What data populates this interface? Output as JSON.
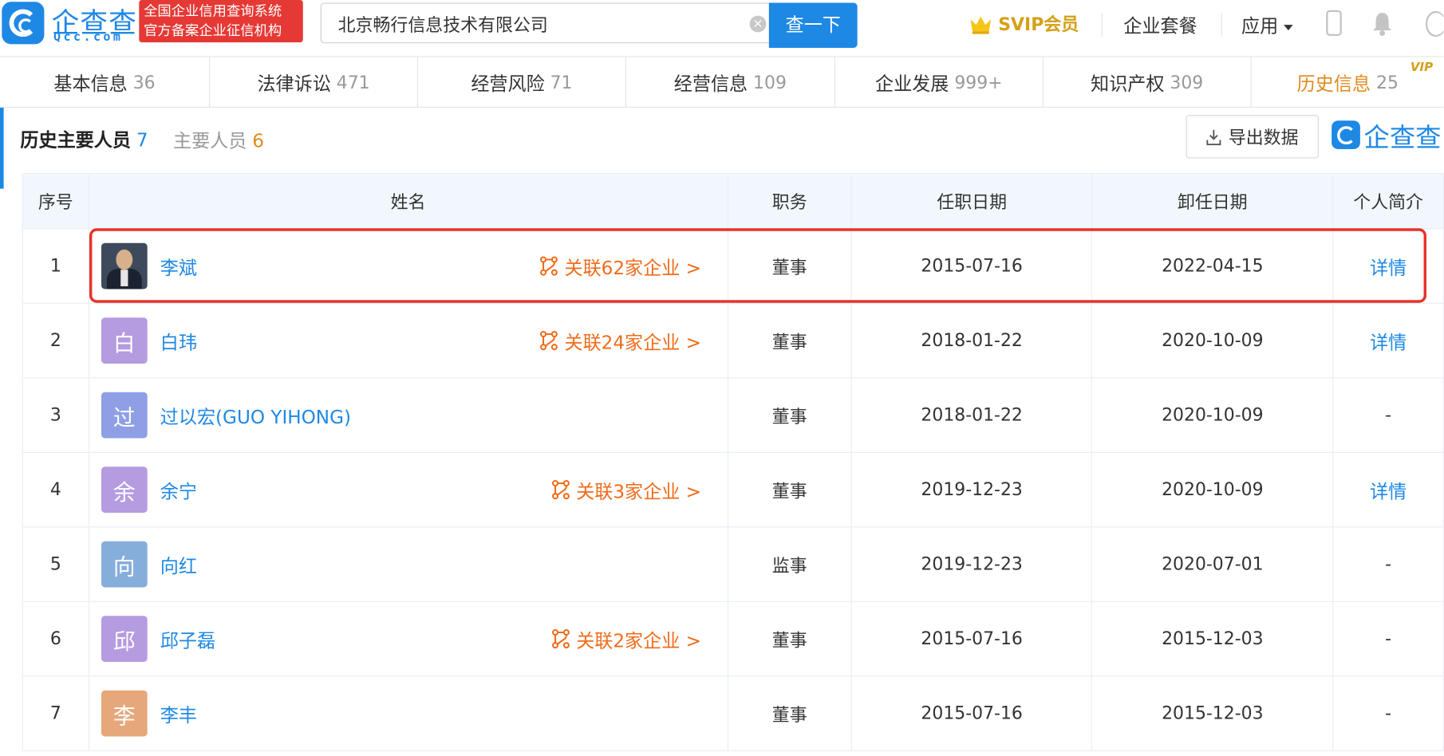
{
  "header": {
    "logo_text": "企查查",
    "logo_domain": "Qcc.com",
    "badge_line1": "全国企业信用查询系统",
    "badge_line2": "官方备案企业征信机构",
    "search_value": "北京畅行信息技术有限公司",
    "search_button": "查一下",
    "svip_label": "SVIP会员",
    "package_label": "企业套餐",
    "apps_label": "应用"
  },
  "tabs": [
    {
      "label": "基本信息",
      "count": "36"
    },
    {
      "label": "法律诉讼",
      "count": "471"
    },
    {
      "label": "经营风险",
      "count": "71"
    },
    {
      "label": "经营信息",
      "count": "109"
    },
    {
      "label": "企业发展",
      "count": "999+"
    },
    {
      "label": "知识产权",
      "count": "309"
    },
    {
      "label": "历史信息",
      "count": "25",
      "vip": "VIP",
      "active": true
    }
  ],
  "section": {
    "title": "历史主要人员",
    "title_count": "7",
    "sub": "主要人员",
    "sub_count": "6",
    "export_label": "导出数据",
    "watermark": "企查查"
  },
  "table": {
    "headers": [
      "序号",
      "姓名",
      "职务",
      "任职日期",
      "卸任日期",
      "个人简介"
    ],
    "rows": [
      {
        "no": "1",
        "avatar_char": "",
        "avatar_color": "#3d4a5c",
        "name": "李斌",
        "related": "关联62家企业 >",
        "position": "董事",
        "start": "2015-07-16",
        "end": "2022-04-15",
        "profile": "详情"
      },
      {
        "no": "2",
        "avatar_char": "白",
        "avatar_color": "#b59be0",
        "name": "白玮",
        "related": "关联24家企业 >",
        "position": "董事",
        "start": "2018-01-22",
        "end": "2020-10-09",
        "profile": "详情"
      },
      {
        "no": "3",
        "avatar_char": "过",
        "avatar_color": "#8f9fe6",
        "name": "过以宏(GUO YIHONG)",
        "related": "",
        "position": "董事",
        "start": "2018-01-22",
        "end": "2020-10-09",
        "profile": "-"
      },
      {
        "no": "4",
        "avatar_char": "余",
        "avatar_color": "#b59be0",
        "name": "余宁",
        "related": "关联3家企业 >",
        "position": "董事",
        "start": "2019-12-23",
        "end": "2020-10-09",
        "profile": "详情"
      },
      {
        "no": "5",
        "avatar_char": "向",
        "avatar_color": "#86aedb",
        "name": "向红",
        "related": "",
        "position": "监事",
        "start": "2019-12-23",
        "end": "2020-07-01",
        "profile": "-"
      },
      {
        "no": "6",
        "avatar_char": "邱",
        "avatar_color": "#b59be0",
        "name": "邱子磊",
        "related": "关联2家企业 >",
        "position": "董事",
        "start": "2015-07-16",
        "end": "2015-12-03",
        "profile": "-"
      },
      {
        "no": "7",
        "avatar_char": "李",
        "avatar_color": "#e6a77a",
        "name": "李丰",
        "related": "",
        "position": "董事",
        "start": "2015-07-16",
        "end": "2015-12-03",
        "profile": "-"
      }
    ]
  },
  "colors": {
    "brand": "#1e88e5",
    "related_link": "#ef6c1a",
    "highlight_box": "#e8322a",
    "active_tab": "#e08a1e"
  }
}
